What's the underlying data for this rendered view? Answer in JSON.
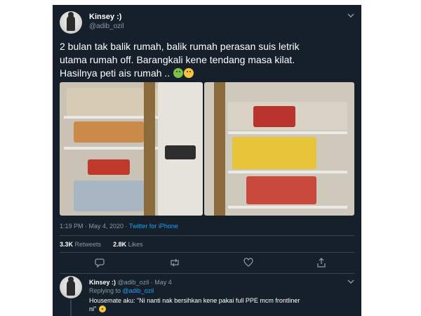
{
  "tweet": {
    "display_name": "Kinsey :)",
    "handle": "@adib_ozil",
    "text_line1": "2 bulan tak balik rumah, balik rumah perasan suis letrik",
    "text_line2": "utama rumah off. Barangkali kene tendang masa kilat.",
    "text_line3": "Hasilnya peti ais rumah ..",
    "emojis": [
      "nauseated-face",
      "face-vomiting"
    ],
    "time": "1:19 PM · May 4, 2020 · ",
    "source": "Twitter for iPhone",
    "retweets_count": "3.3K",
    "retweets_label": "Retweets",
    "likes_count": "2.8K",
    "likes_label": "Likes",
    "actions": [
      "reply-icon",
      "retweet-icon",
      "like-icon",
      "share-icon"
    ]
  },
  "reply": {
    "display_name": "Kinsey :)",
    "handle_date": "@adib_ozil · May 4",
    "replying_prefix": "Replying to ",
    "replying_to": "@adib_ozil",
    "text_line1": "Housemate aku: \"Ni nanti nak bersihkan kene pakai full PPE mcm frontliner",
    "text_line2": "ni\"",
    "emoji": "grinning-sweat-face"
  },
  "colors": {
    "background": "#15202b",
    "text": "#ffffff",
    "muted": "#8899a6",
    "link": "#1da1f2",
    "divider": "#38444d"
  }
}
